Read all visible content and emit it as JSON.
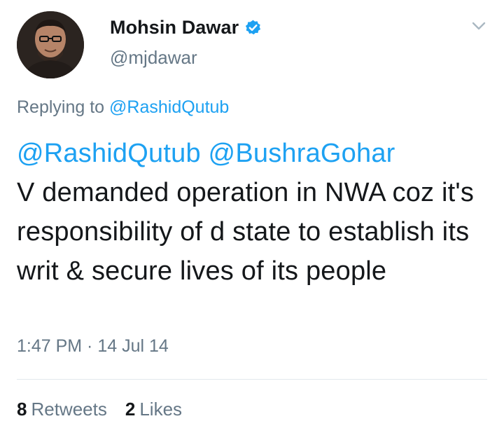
{
  "author": {
    "display_name": "Mohsin Dawar",
    "handle": "@mjdawar",
    "verified": true,
    "avatar_icon": "user-avatar-photo"
  },
  "menu": {
    "icon": "chevron-down-icon"
  },
  "reply_context": {
    "prefix": "Replying to",
    "target": "@RashidQutub"
  },
  "tweet": {
    "mentions": [
      "@RashidQutub",
      "@BushraGohar"
    ],
    "body": "V demanded operation in NWA coz it's responsibility of d state to establish its writ & secure lives of its people",
    "timestamp": "1:47 PM · 14 Jul 14"
  },
  "stats": {
    "retweets_count": "8",
    "retweets_label": "Retweets",
    "likes_count": "2",
    "likes_label": "Likes"
  },
  "colors": {
    "link_blue": "#1da1f2",
    "secondary_gray": "#657786",
    "text_dark": "#14171a",
    "divider": "#e1e8ed"
  }
}
